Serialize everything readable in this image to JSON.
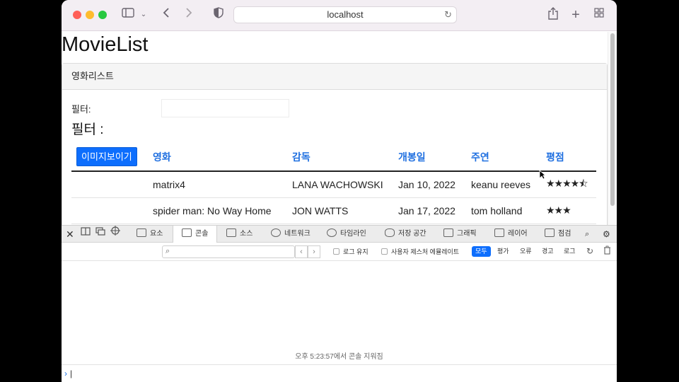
{
  "browser": {
    "url": "localhost",
    "icons": [
      "sidebar-icon",
      "chevron-down-icon",
      "back-icon",
      "forward-icon",
      "shield-icon",
      "reload-icon",
      "share-icon",
      "new-tab-icon",
      "tab-overview-icon"
    ]
  },
  "page": {
    "title": "MovieList",
    "card_header": "영화리스트",
    "filter_label": "필터:",
    "filter_value": "",
    "filter_heading": "필터 :",
    "table": {
      "button_label": "이미지보이기",
      "headers": [
        "영화",
        "감독",
        "개봉일",
        "주연",
        "평점"
      ],
      "rows": [
        {
          "movie": "matrix4",
          "director": "LANA WACHOWSKI",
          "release": "Jan 10, 2022",
          "star": "keanu reeves",
          "rating": 4.5,
          "rating_display": "★★★★⯪"
        },
        {
          "movie": "spider man: No Way Home",
          "director": "JON WATTS",
          "release": "Jan 17, 2022",
          "star": "tom holland",
          "rating": 3,
          "rating_display": "★★★"
        }
      ]
    }
  },
  "devtools": {
    "tabs": [
      "요소",
      "콘솔",
      "소스",
      "네트워크",
      "타임라인",
      "저장 공간",
      "그래픽",
      "레이어",
      "점검"
    ],
    "active_tab": "콘솔",
    "preserve_log": "로그 유지",
    "user_gesture": "사용자 제스처 에뮬레이트",
    "levels": [
      "모두",
      "평가",
      "오류",
      "경고",
      "로그"
    ],
    "active_level": "모두",
    "cleared_message": "오후 5:23:57에서 콘솔 지워짐",
    "prompt_symbol": "›"
  },
  "colors": {
    "accent": "#0d6efd",
    "header_link": "#1f6fe0"
  }
}
